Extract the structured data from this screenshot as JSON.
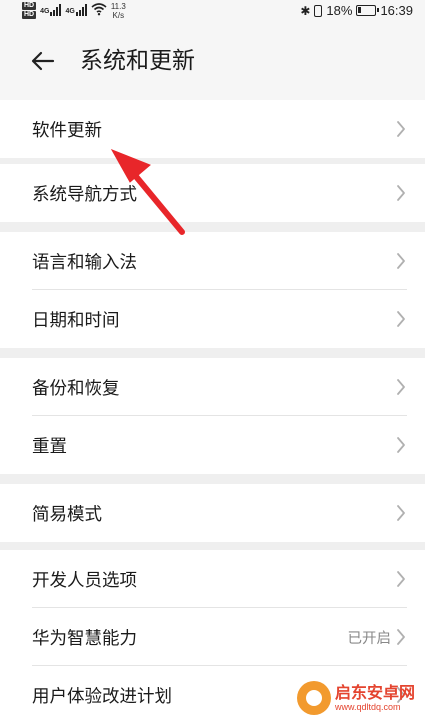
{
  "status_bar": {
    "hd1": "HD",
    "hd2": "HD",
    "net1": "4G",
    "net2": "4G",
    "speed_value": "11.3",
    "speed_unit": "K/s",
    "battery_text": "18%",
    "battery_level": 0.18,
    "time": "16:39"
  },
  "header": {
    "title": "系统和更新",
    "back_icon": "arrow-left-icon"
  },
  "groups": [
    {
      "items": [
        {
          "label": "软件更新"
        }
      ]
    },
    {
      "items": [
        {
          "label": "系统导航方式"
        }
      ]
    },
    {
      "items": [
        {
          "label": "语言和输入法"
        },
        {
          "label": "日期和时间"
        }
      ]
    },
    {
      "items": [
        {
          "label": "备份和恢复"
        },
        {
          "label": "重置"
        }
      ]
    },
    {
      "items": [
        {
          "label": "简易模式"
        }
      ]
    },
    {
      "items": [
        {
          "label": "开发人员选项"
        },
        {
          "label": "华为智慧能力",
          "value": "已开启"
        },
        {
          "label": "用户体验改进计划"
        }
      ]
    }
  ],
  "annotation": {
    "color": "#e8262a"
  },
  "watermark": {
    "title": "启东安卓网",
    "url": "www.qdltdq.com"
  },
  "colors": {
    "background": "#efefef",
    "card": "#ffffff",
    "chevron": "#b0b0b0"
  }
}
